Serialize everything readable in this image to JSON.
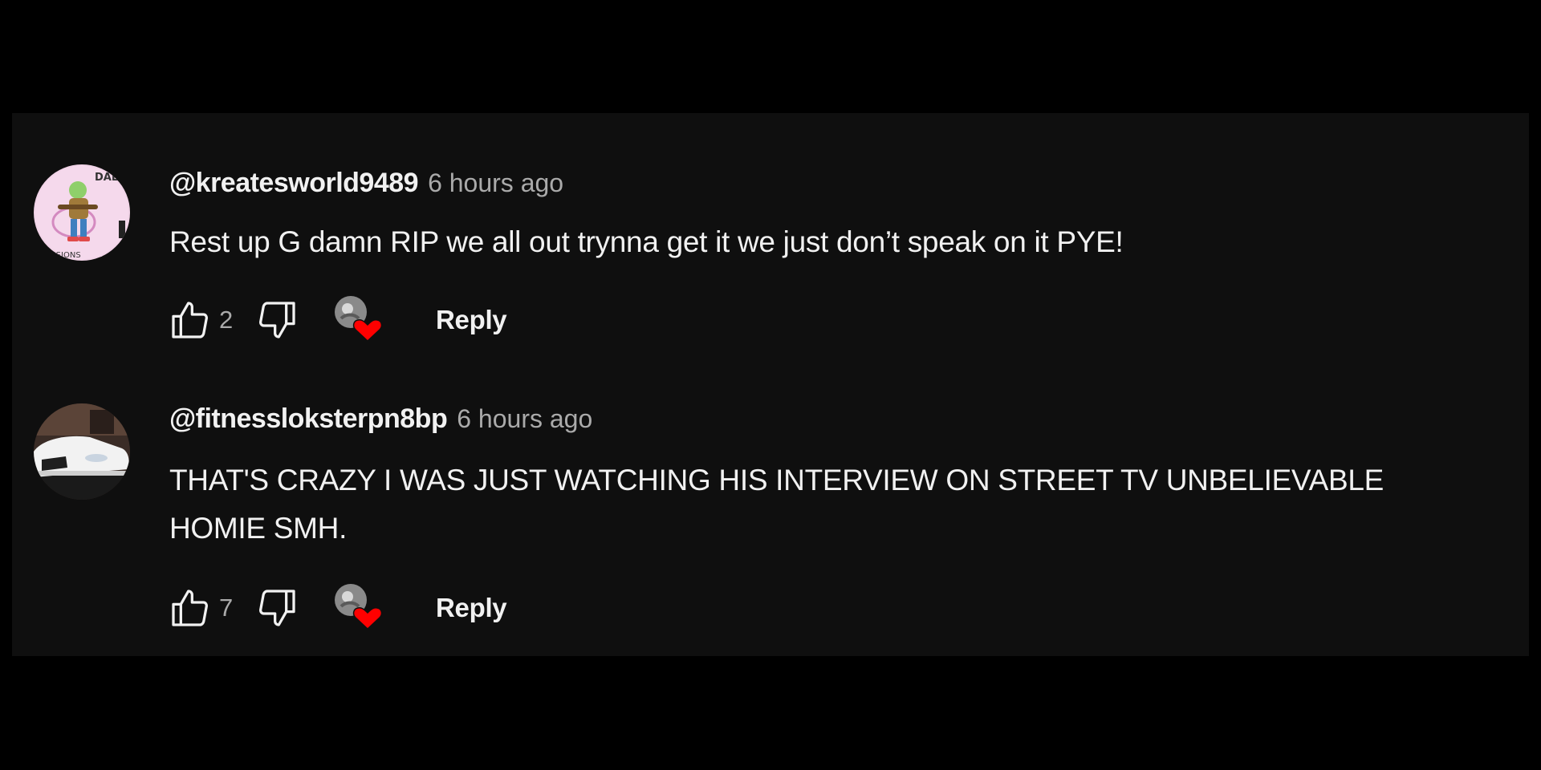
{
  "comments": [
    {
      "handle": "@kreatesworld9489",
      "time": "6 hours ago",
      "text": "Rest up G damn RIP we all out trynna get it we just don’t speak on it PYE!",
      "likes": "2",
      "reply_label": "Reply",
      "avatar_icon": "cartoon-character-avatar",
      "avatar_text_top": "DAL",
      "avatar_text_bottom": "USSIONS"
    },
    {
      "handle": "@fitnessloksterpn8bp",
      "time": "6 hours ago",
      "text": "THAT'S CRAZY I WAS JUST WATCHING HIS INTERVIEW ON STREET TV UNBELIEVABLE HOMIE SMH.",
      "likes": "7",
      "reply_label": "Reply",
      "avatar_icon": "white-car-avatar"
    }
  ],
  "colors": {
    "background": "#000000",
    "panel": "#0f0f0f",
    "primary_text": "#f1f1f1",
    "secondary_text": "#aaaaaa",
    "heart": "#ff0000"
  }
}
